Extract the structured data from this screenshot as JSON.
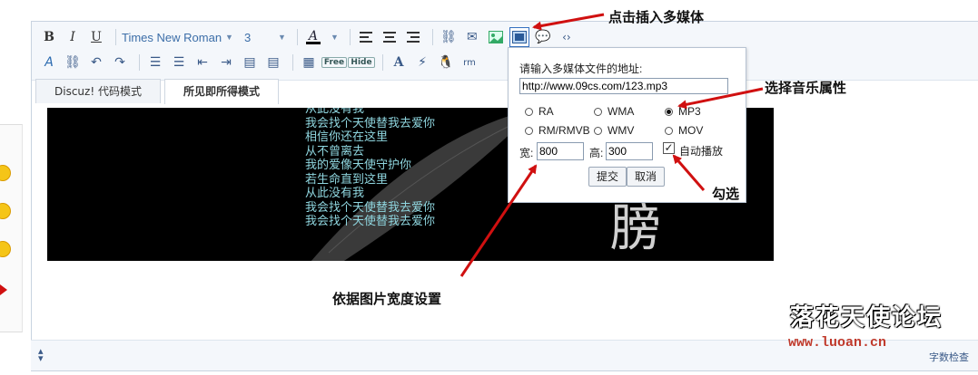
{
  "toolbar": {
    "bold_label": "B",
    "italic_label": "I",
    "underline_label": "U",
    "font_family": "Times New Roman",
    "font_size": "3",
    "text_color_glyph": "A",
    "free_label": "Free",
    "hide_label": "Hide"
  },
  "tabs": [
    {
      "label": "Discuz! 代码模式",
      "active": false
    },
    {
      "label": "所见即所得模式",
      "active": true
    }
  ],
  "content": {
    "lyrics": "从此没有我\n我会找个天使替我去爱你\n相信你还在这里\n从不曾离去\n我的爱像天使守护你\n若生命直到这里\n从此没有我\n我会找个天使替我去爱你\n我会找个天使替我去爱你",
    "image_char": "膀"
  },
  "popup": {
    "prompt": "请输入多媒体文件的地址:",
    "url_value": "http://www.09cs.com/123.mp3",
    "formats": [
      {
        "label": "RA",
        "checked": false
      },
      {
        "label": "WMA",
        "checked": false
      },
      {
        "label": "MP3",
        "checked": true
      },
      {
        "label": "RM/RMVB",
        "checked": false
      },
      {
        "label": "WMV",
        "checked": false
      },
      {
        "label": "MOV",
        "checked": false
      }
    ],
    "width_label": "宽:",
    "width_value": "800",
    "height_label": "高:",
    "height_value": "300",
    "autoplay_label": "自动播放",
    "autoplay_checked": true,
    "submit_label": "提交",
    "cancel_label": "取消"
  },
  "annotations": {
    "insert_media": "点击插入多媒体",
    "select_music": "选择音乐属性",
    "check": "勾选",
    "width_by_image": "依据图片宽度设置"
  },
  "bottom_bar": {
    "word_check": "字数检查"
  },
  "watermark": {
    "logo_text": "落花天使论坛",
    "url": "www.luoan.cn"
  },
  "colors": {
    "accent": "#3470c0",
    "annotation_arrow": "#d01010",
    "lyrics_text": "#8fd6df"
  }
}
